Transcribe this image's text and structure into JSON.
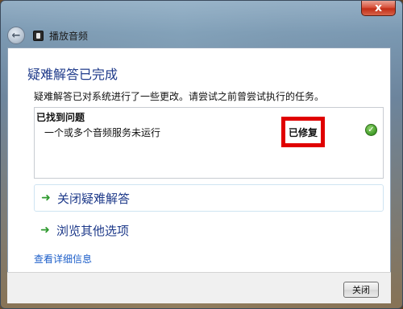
{
  "window": {
    "title": "播放音频",
    "close_glyph": "x"
  },
  "page": {
    "heading": "疑难解答已完成",
    "description": "疑难解答已对系统进行了一些更改。请尝试之前曾尝试执行的任务。",
    "issues_panel": {
      "heading": "已找到问题",
      "issues": [
        {
          "text": "一个或多个音频服务未运行",
          "status": "已修复",
          "status_icon": "check-icon"
        }
      ]
    },
    "options": [
      {
        "label": "关闭疑难解答",
        "icon": "green-arrow-icon"
      },
      {
        "label": "浏览其他选项",
        "icon": "green-arrow-icon"
      }
    ],
    "details_link": "查看详细信息"
  },
  "footer": {
    "close_button": "关闭"
  },
  "colors": {
    "heading": "#1e3a8a",
    "link": "#1c5ec9",
    "highlight_border": "#e00000",
    "success": "#3f9a27"
  }
}
